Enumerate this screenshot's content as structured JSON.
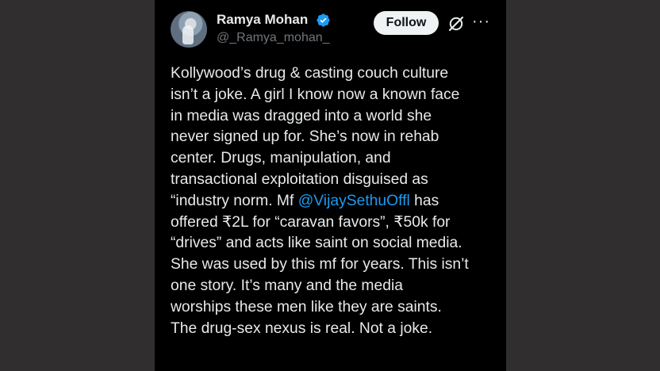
{
  "user": {
    "name": "Ramya Mohan",
    "handle": "@_Ramya_mohan_"
  },
  "actions": {
    "follow_label": "Follow",
    "more_label": "···"
  },
  "icons": {
    "verified": "verified-badge-icon",
    "grok": "grok-icon",
    "more": "more-icon"
  },
  "colors": {
    "background": "#000000",
    "text": "#e7e9ea",
    "secondary_text": "#71767b",
    "link": "#1d9bf0",
    "verified": "#1d9bf0"
  },
  "tweet": {
    "lines": [
      "Kollywood’s drug & casting couch culture",
      "isn’t a joke. A girl I know now a known face",
      "in media was dragged into a world she",
      "never signed up for. She’s now in  rehab",
      "center. Drugs, manipulation, and",
      "transactional exploitation disguised as",
      "“industry norm. Mf ",
      "@VijaySethuOffl",
      " has",
      "offered ₹2L for “caravan favors”, ₹50k for",
      "“drives” and acts like saint on social media.",
      "She was used by this mf for years. This isn’t",
      "one story. It’s many and the media",
      "worships these men like they are saints.",
      "The drug-sex nexus is real. Not a joke."
    ]
  }
}
